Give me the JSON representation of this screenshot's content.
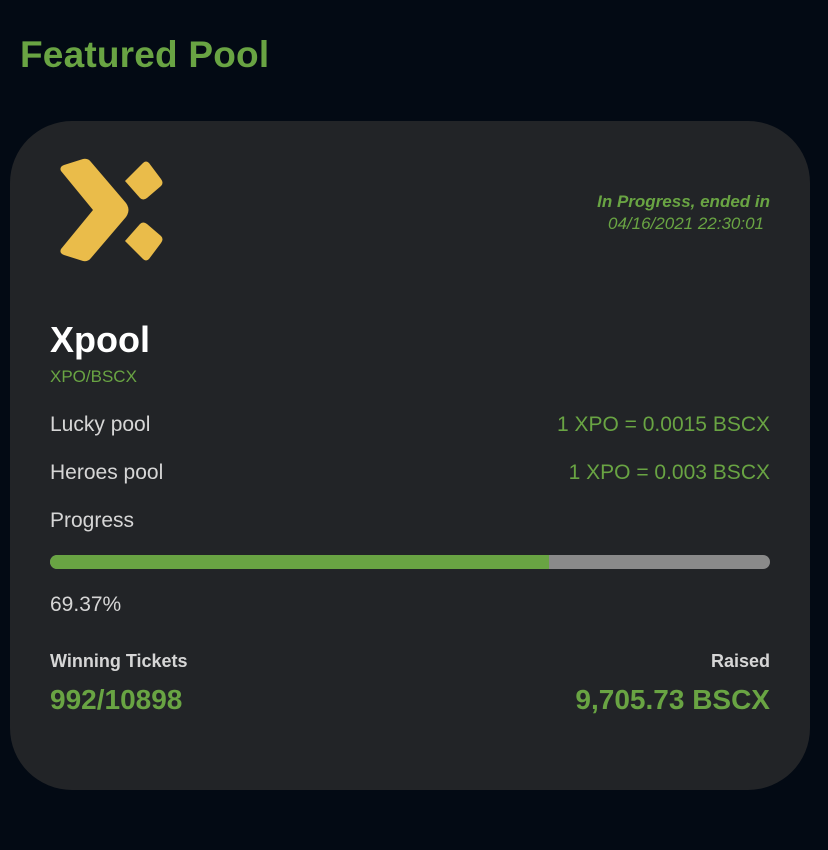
{
  "page": {
    "title": "Featured Pool"
  },
  "pool": {
    "name": "Xpool",
    "pair": "XPO/BSCX",
    "logo_icon": "xpool-logo",
    "status_line1": "In Progress, ended in",
    "status_line2": "04/16/2021 22:30:01",
    "lucky_label": "Lucky pool",
    "lucky_rate": "1 XPO = 0.0015 BSCX",
    "heroes_label": "Heroes pool",
    "heroes_rate": "1 XPO = 0.003 BSCX",
    "progress_label": "Progress",
    "progress_value": "69.37%",
    "progress_fraction": 0.6937,
    "winning_label": "Winning Tickets",
    "winning_value": "992/10898",
    "raised_label": "Raised",
    "raised_value": "9,705.73 BSCX"
  },
  "colors": {
    "accent": "#69a443",
    "logo": "#eabc4a",
    "card": "#222427",
    "background": "#030a14",
    "track": "#8a8a8a"
  }
}
